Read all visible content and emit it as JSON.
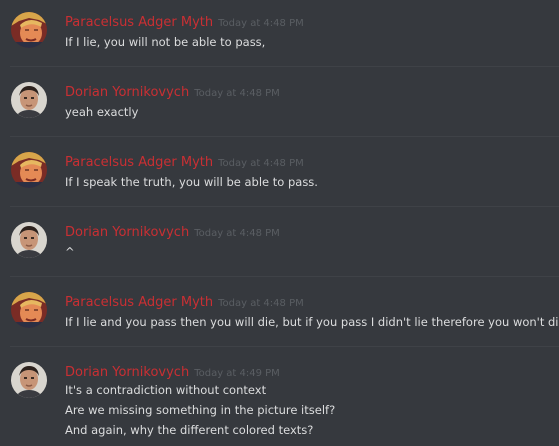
{
  "colors": {
    "background": "#36393e",
    "username": "#c92f33",
    "timestamp": "#5a5e63",
    "message_text": "#dcddde",
    "divider": "#3f4247"
  },
  "messages": [
    {
      "author": "Paracelsus Adger Myth",
      "avatar_icon": "trump-avatar-icon",
      "timestamp": "Today at 4:48 PM",
      "lines": [
        "If I lie, you will not be able to pass,"
      ]
    },
    {
      "author": "Dorian Yornikovych",
      "avatar_icon": "man-avatar-icon",
      "timestamp": "Today at 4:48 PM",
      "lines": [
        "yeah exactly"
      ]
    },
    {
      "author": "Paracelsus Adger Myth",
      "avatar_icon": "trump-avatar-icon",
      "timestamp": "Today at 4:48 PM",
      "lines": [
        "If I speak the truth, you will be able to pass."
      ]
    },
    {
      "author": "Dorian Yornikovych",
      "avatar_icon": "man-avatar-icon",
      "timestamp": "Today at 4:48 PM",
      "lines": [
        "^"
      ]
    },
    {
      "author": "Paracelsus Adger Myth",
      "avatar_icon": "trump-avatar-icon",
      "timestamp": "Today at 4:48 PM",
      "lines": [
        "If I lie and you pass then you will die, but if you pass I didn't lie therefore you won't die."
      ]
    },
    {
      "author": "Dorian Yornikovych",
      "avatar_icon": "man-avatar-icon",
      "timestamp": "Today at 4:49 PM",
      "lines": [
        "It's a contradiction without context",
        "Are we missing something in the picture itself?",
        "And again, why the different colored texts?"
      ]
    }
  ]
}
